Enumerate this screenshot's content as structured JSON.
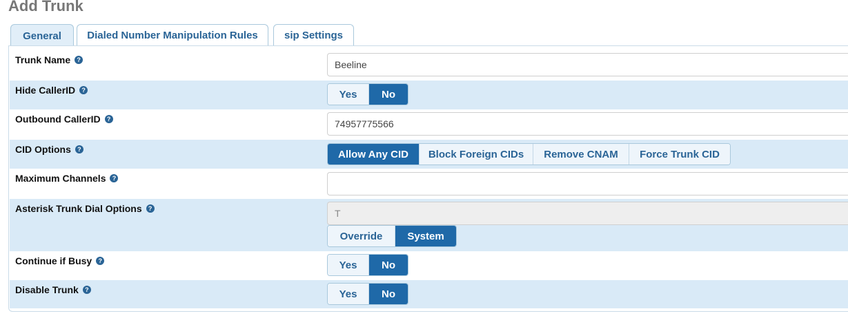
{
  "page": {
    "title": "Add Trunk"
  },
  "tabs": [
    {
      "label": "General"
    },
    {
      "label": "Dialed Number Manipulation Rules"
    },
    {
      "label": "sip Settings"
    }
  ],
  "help_icon": "question-circle-icon",
  "form": {
    "trunk_name": {
      "label": "Trunk Name",
      "value": "Beeline"
    },
    "hide_callerid": {
      "label": "Hide CallerID",
      "options": [
        "Yes",
        "No"
      ],
      "selected": "No"
    },
    "outbound_callerid": {
      "label": "Outbound CallerID",
      "value": "74957775566"
    },
    "cid_options": {
      "label": "CID Options",
      "options": [
        "Allow Any CID",
        "Block Foreign CIDs",
        "Remove CNAM",
        "Force Trunk CID"
      ],
      "selected": "Allow Any CID"
    },
    "maximum_channels": {
      "label": "Maximum Channels",
      "value": ""
    },
    "dial_options": {
      "label": "Asterisk Trunk Dial Options",
      "value": "T",
      "options": [
        "Override",
        "System"
      ],
      "selected": "System"
    },
    "continue_if_busy": {
      "label": "Continue if Busy",
      "options": [
        "Yes",
        "No"
      ],
      "selected": "No"
    },
    "disable_trunk": {
      "label": "Disable Trunk",
      "options": [
        "Yes",
        "No"
      ],
      "selected": "No"
    }
  },
  "colors": {
    "accent": "#1f69a8",
    "row_alt": "#d9eaf7",
    "link": "#2a6496"
  }
}
